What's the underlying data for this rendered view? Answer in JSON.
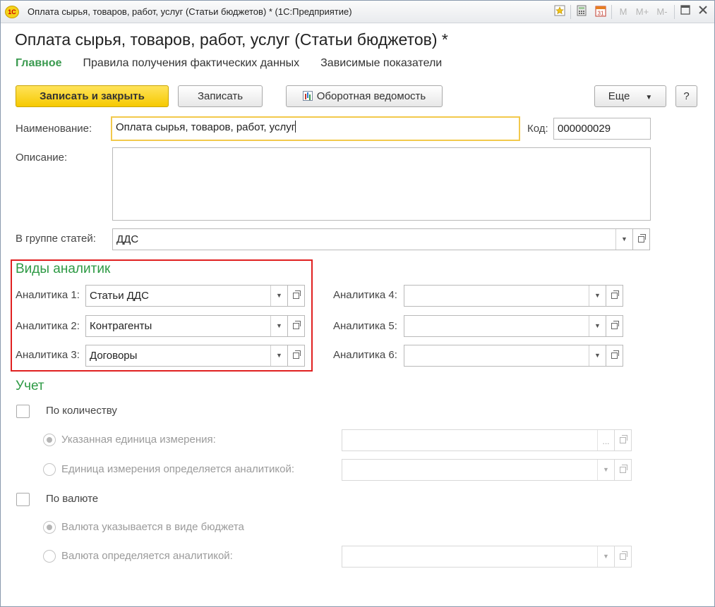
{
  "window": {
    "title": "Оплата сырья, товаров, работ, услуг (Статьи бюджетов) * (1С:Предприятие)",
    "logo_text": "1С",
    "toolbar_icons": [
      "favorite-star-icon",
      "calculator-icon",
      "calendar-icon",
      "memory-m-icon",
      "memory-plus-icon",
      "memory-minus-icon",
      "restore-icon",
      "close-icon"
    ],
    "calendar_day": "31",
    "mem_labels": [
      "M",
      "M+",
      "M-"
    ]
  },
  "form": {
    "title": "Оплата сырья, товаров, работ, услуг (Статьи бюджетов) *",
    "tabs": [
      "Главное",
      "Правила получения фактических данных",
      "Зависимые показатели"
    ]
  },
  "toolbar": {
    "save_close": "Записать и закрыть",
    "save": "Записать",
    "turnover": "Оборотная ведомость",
    "more": "Еще",
    "help": "?"
  },
  "fields": {
    "name_label": "Наименование:",
    "name_value": "Оплата сырья, товаров, работ, услуг",
    "code_label": "Код:",
    "code_value": "000000029",
    "description_label": "Описание:",
    "description_value": "",
    "group_label": "В группе статей:",
    "group_value": "ДДС"
  },
  "analytics": {
    "title": "Виды аналитик",
    "left": [
      {
        "label": "Аналитика 1:",
        "value": "Статьи ДДС"
      },
      {
        "label": "Аналитика 2:",
        "value": "Контрагенты"
      },
      {
        "label": "Аналитика 3:",
        "value": "Договоры"
      }
    ],
    "right": [
      {
        "label": "Аналитика 4:",
        "value": ""
      },
      {
        "label": "Аналитика 5:",
        "value": ""
      },
      {
        "label": "Аналитика 6:",
        "value": ""
      }
    ]
  },
  "accounting": {
    "title": "Учет",
    "by_quantity": "По количеству",
    "unit_specified": "Указанная единица измерения:",
    "unit_by_analytics": "Единица измерения определяется аналитикой:",
    "by_currency": "По валюте",
    "currency_in_budget": "Валюта указывается в виде бюджета",
    "currency_by_analytics": "Валюта определяется аналитикой:",
    "ellipsis": "..."
  },
  "colors": {
    "accent_green": "#3a9a4f",
    "primary_button": "#f6c900",
    "highlight": "#e02020"
  }
}
